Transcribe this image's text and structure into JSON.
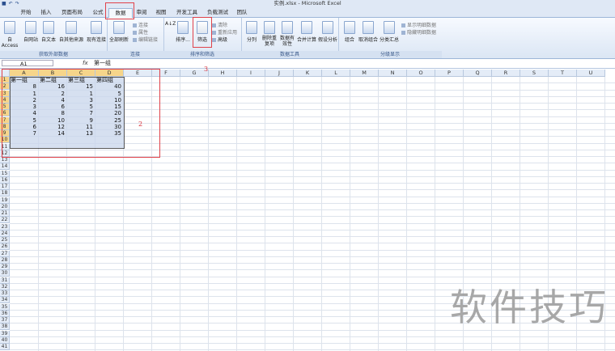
{
  "window": {
    "title": "实例.xlsx - Microsoft Excel"
  },
  "tabs": [
    "开始",
    "插入",
    "页面布局",
    "公式",
    "数据",
    "审阅",
    "视图",
    "开发工具",
    "负载测试",
    "团队"
  ],
  "active_tab": "数据",
  "ribbon": {
    "get_external": {
      "label": "获取外部数据",
      "buttons": [
        "自 Access",
        "自网站",
        "自文本",
        "自其他来源",
        "现有连接"
      ]
    },
    "connections": {
      "label": "连接",
      "refresh": "全部刷新",
      "small": [
        "连接",
        "属性",
        "编辑链接"
      ]
    },
    "sort_filter": {
      "label": "排序和筛选",
      "sort": "排序...",
      "filter": "筛选",
      "small": [
        "清除",
        "重新应用",
        "高级"
      ]
    },
    "data_tools": {
      "label": "数据工具",
      "buttons": [
        "分列",
        "删除重复项",
        "数据有效性",
        "合并计算",
        "假设分析"
      ]
    },
    "outline": {
      "label": "分级显示",
      "buttons": [
        "组合",
        "取消组合",
        "分类汇总"
      ],
      "small": [
        "显示明细数据",
        "隐藏明细数据"
      ]
    }
  },
  "formula_bar": {
    "name_box": "A1",
    "fx": "fx",
    "value": "第一组"
  },
  "columns": [
    "A",
    "B",
    "C",
    "D",
    "E",
    "F",
    "G",
    "H",
    "I",
    "J",
    "K",
    "L",
    "M",
    "N",
    "O",
    "P",
    "Q",
    "R",
    "S",
    "T",
    "U"
  ],
  "rows": [
    "1",
    "2",
    "3",
    "4",
    "5",
    "6",
    "7",
    "8",
    "9",
    "10",
    "11",
    "12",
    "13",
    "14",
    "15",
    "16",
    "17",
    "18",
    "19",
    "20",
    "21",
    "22",
    "23",
    "24",
    "25",
    "26",
    "27",
    "28",
    "29",
    "30",
    "31",
    "32",
    "33",
    "34",
    "35",
    "36",
    "37",
    "38",
    "39",
    "40",
    "41"
  ],
  "table": {
    "headers": [
      "第一组",
      "第二组",
      "第三组",
      "第四组"
    ],
    "rows": [
      [
        "8",
        "16",
        "15",
        "40"
      ],
      [
        "1",
        "2",
        "1",
        "5"
      ],
      [
        "2",
        "4",
        "3",
        "10"
      ],
      [
        "3",
        "6",
        "5",
        "15"
      ],
      [
        "4",
        "8",
        "7",
        "20"
      ],
      [
        "5",
        "10",
        "9",
        "25"
      ],
      [
        "6",
        "12",
        "11",
        "30"
      ],
      [
        "7",
        "14",
        "13",
        "35"
      ]
    ]
  },
  "annotations": {
    "marker_2": "2",
    "marker_3": "3",
    "color": "#e0424a"
  },
  "watermark": "软件技巧"
}
